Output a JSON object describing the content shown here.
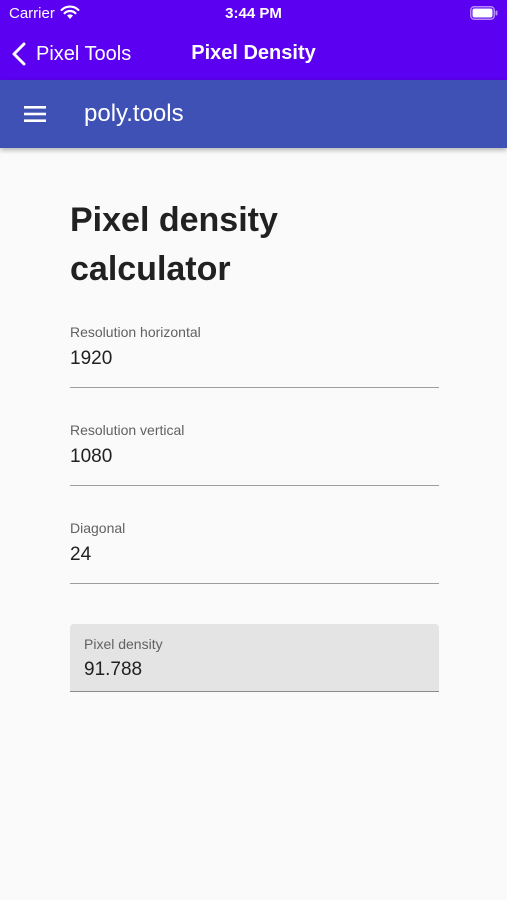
{
  "status_bar": {
    "carrier": "Carrier",
    "time": "3:44 PM",
    "icons": [
      "wifi-icon",
      "battery-icon"
    ]
  },
  "nav": {
    "back_label": "Pixel Tools",
    "title": "Pixel Density",
    "icons": [
      "chevron-left-icon"
    ]
  },
  "app_bar": {
    "title": "poly.tools",
    "icons": [
      "hamburger-menu-icon"
    ]
  },
  "page": {
    "title": "Pixel density calculator",
    "fields": [
      {
        "label": "Resolution horizontal",
        "value": "1920"
      },
      {
        "label": "Resolution vertical",
        "value": "1080"
      },
      {
        "label": "Diagonal",
        "value": "24"
      }
    ],
    "result": {
      "label": "Pixel density",
      "value": "91.788"
    }
  },
  "colors": {
    "nav_background": "#5b00f0",
    "app_bar_background": "#3f51b5",
    "page_background": "#fafafa",
    "result_background": "#e4e4e4"
  }
}
